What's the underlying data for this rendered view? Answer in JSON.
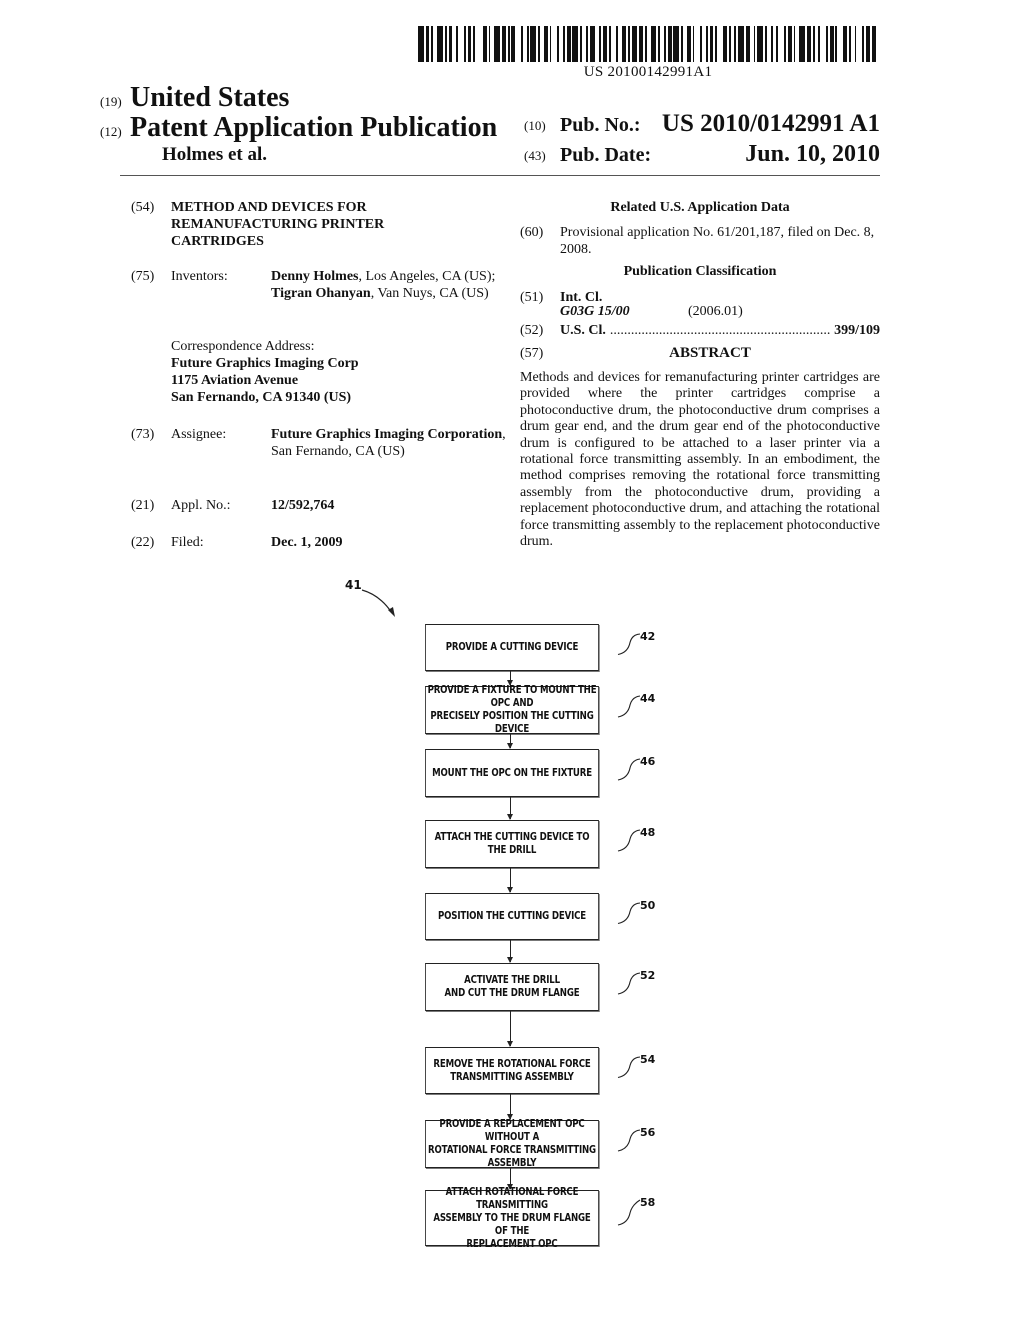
{
  "header": {
    "barcode_text": "US 20100142991A1",
    "country_code": "(19)",
    "country": "United States",
    "type_code": "(12)",
    "type": "Patent Application Publication",
    "authors": "Holmes et al.",
    "pub_no_code": "(10)",
    "pub_no_label": "Pub. No.:",
    "pub_no": "US 2010/0142991 A1",
    "pub_date_code": "(43)",
    "pub_date_label": "Pub. Date:",
    "pub_date": "Jun. 10, 2010"
  },
  "left": {
    "title_code": "(54)",
    "title_lines": [
      "METHOD AND DEVICES FOR",
      "REMANUFACTURING PRINTER",
      "CARTRIDGES"
    ],
    "inventors_code": "(75)",
    "inventors_label": "Inventors:",
    "inventor1_name": "Denny Holmes",
    "inventor1_loc": ", Los Angeles, CA (US); ",
    "inventor2_name": "Tigran Ohanyan",
    "inventor2_loc": ", Van Nuys, CA (US)",
    "correspondence_label": "Correspondence Address:",
    "correspondence_lines": [
      "Future Graphics Imaging Corp",
      "1175 Aviation Avenue",
      "San Fernando, CA 91340 (US)"
    ],
    "assignee_code": "(73)",
    "assignee_label": "Assignee:",
    "assignee_name": "Future Graphics Imaging Corporation",
    "assignee_loc": ", San Fernando, CA (US)",
    "appl_code": "(21)",
    "appl_label": "Appl. No.:",
    "appl_no": "12/592,764",
    "filed_code": "(22)",
    "filed_label": "Filed:",
    "filed": "Dec. 1, 2009"
  },
  "right": {
    "related_heading": "Related U.S. Application Data",
    "provisional_code": "(60)",
    "provisional": "Provisional application No. 61/201,187, filed on Dec. 8, 2008.",
    "classification_heading": "Publication Classification",
    "int_cl_code": "(51)",
    "int_cl_label": "Int. Cl.",
    "int_cl_value": "G03G 15/00",
    "int_cl_year": "(2006.01)",
    "us_cl_code": "(52)",
    "us_cl_label": "U.S. Cl.",
    "us_cl_value": "399/109",
    "abstract_code": "(57)",
    "abstract_heading": "ABSTRACT",
    "abstract": "Methods and devices for remanufacturing printer cartridges are provided where the printer cartridges comprise a photoconductive drum, the photoconductive drum comprises a drum gear end, and the drum gear end of the photoconductive drum is configured to be attached to a laser printer via a rotational force transmitting assembly. In an embodiment, the method comprises removing the rotational force transmitting assembly from the photoconductive drum, providing a replacement photoconductive drum, and attaching the rotational force transmitting assembly to the replacement photoconductive drum."
  },
  "figure": {
    "label": "41",
    "steps": [
      {
        "text": "PROVIDE A CUTTING DEVICE",
        "ref": "42"
      },
      {
        "text": "PROVIDE A FIXTURE TO MOUNT THE OPC AND\nPRECISELY POSITION THE CUTTING DEVICE",
        "ref": "44"
      },
      {
        "text": "MOUNT THE OPC ON THE FIXTURE",
        "ref": "46"
      },
      {
        "text": "ATTACH THE CUTTING DEVICE TO\nTHE DRILL",
        "ref": "48"
      },
      {
        "text": "POSITION THE CUTTING DEVICE",
        "ref": "50"
      },
      {
        "text": "ACTIVATE THE DRILL\nAND CUT THE DRUM FLANGE",
        "ref": "52"
      },
      {
        "text": "REMOVE THE ROTATIONAL FORCE\nTRANSMITTING ASSEMBLY",
        "ref": "54"
      },
      {
        "text": "PROVIDE A REPLACEMENT OPC WITHOUT A\nROTATIONAL FORCE TRANSMITTING ASSEMBLY",
        "ref": "56"
      },
      {
        "text": "ATTACH ROTATIONAL FORCE TRANSMITTING\nASSEMBLY TO THE DRUM FLANGE OF THE\nREPLACEMENT OPC",
        "ref": "58"
      }
    ]
  }
}
